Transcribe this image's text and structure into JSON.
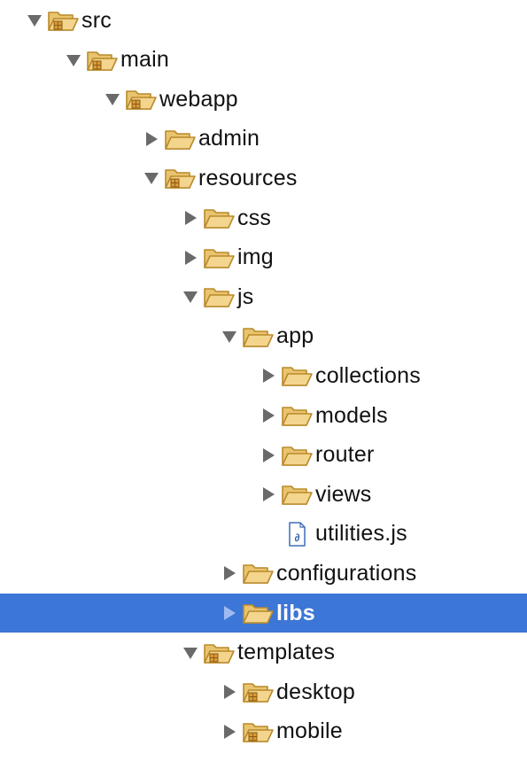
{
  "tree": {
    "rows": [
      {
        "label": "src",
        "depth": 0,
        "toggle": "expanded",
        "icon": "source-folder-icon"
      },
      {
        "label": "main",
        "depth": 1,
        "toggle": "expanded",
        "icon": "source-folder-icon"
      },
      {
        "label": "webapp",
        "depth": 2,
        "toggle": "expanded",
        "icon": "source-folder-icon"
      },
      {
        "label": "admin",
        "depth": 3,
        "toggle": "collapsed",
        "icon": "folder-icon"
      },
      {
        "label": "resources",
        "depth": 3,
        "toggle": "expanded",
        "icon": "source-folder-icon"
      },
      {
        "label": "css",
        "depth": 4,
        "toggle": "collapsed",
        "icon": "folder-icon"
      },
      {
        "label": "img",
        "depth": 4,
        "toggle": "collapsed",
        "icon": "folder-icon"
      },
      {
        "label": "js",
        "depth": 4,
        "toggle": "expanded",
        "icon": "folder-icon"
      },
      {
        "label": "app",
        "depth": 5,
        "toggle": "expanded",
        "icon": "folder-icon"
      },
      {
        "label": "collections",
        "depth": 6,
        "toggle": "collapsed",
        "icon": "folder-icon"
      },
      {
        "label": "models",
        "depth": 6,
        "toggle": "collapsed",
        "icon": "folder-icon"
      },
      {
        "label": "router",
        "depth": 6,
        "toggle": "collapsed",
        "icon": "folder-icon"
      },
      {
        "label": "views",
        "depth": 6,
        "toggle": "collapsed",
        "icon": "folder-icon"
      },
      {
        "label": "utilities.js",
        "depth": 6,
        "toggle": "none",
        "icon": "js-file-icon"
      },
      {
        "label": "configurations",
        "depth": 5,
        "toggle": "collapsed",
        "icon": "folder-icon"
      },
      {
        "label": "libs",
        "depth": 5,
        "toggle": "collapsed",
        "icon": "folder-icon",
        "selected": true
      },
      {
        "label": "templates",
        "depth": 4,
        "toggle": "expanded",
        "icon": "source-folder-icon"
      },
      {
        "label": "desktop",
        "depth": 5,
        "toggle": "collapsed",
        "icon": "source-folder-icon"
      },
      {
        "label": "mobile",
        "depth": 5,
        "toggle": "collapsed",
        "icon": "source-folder-icon"
      }
    ]
  },
  "colors": {
    "selection": "#3c76d6",
    "folder_fill": "#f3d58e",
    "folder_stroke": "#b98a2a",
    "arrow": "#6a6a6a"
  }
}
